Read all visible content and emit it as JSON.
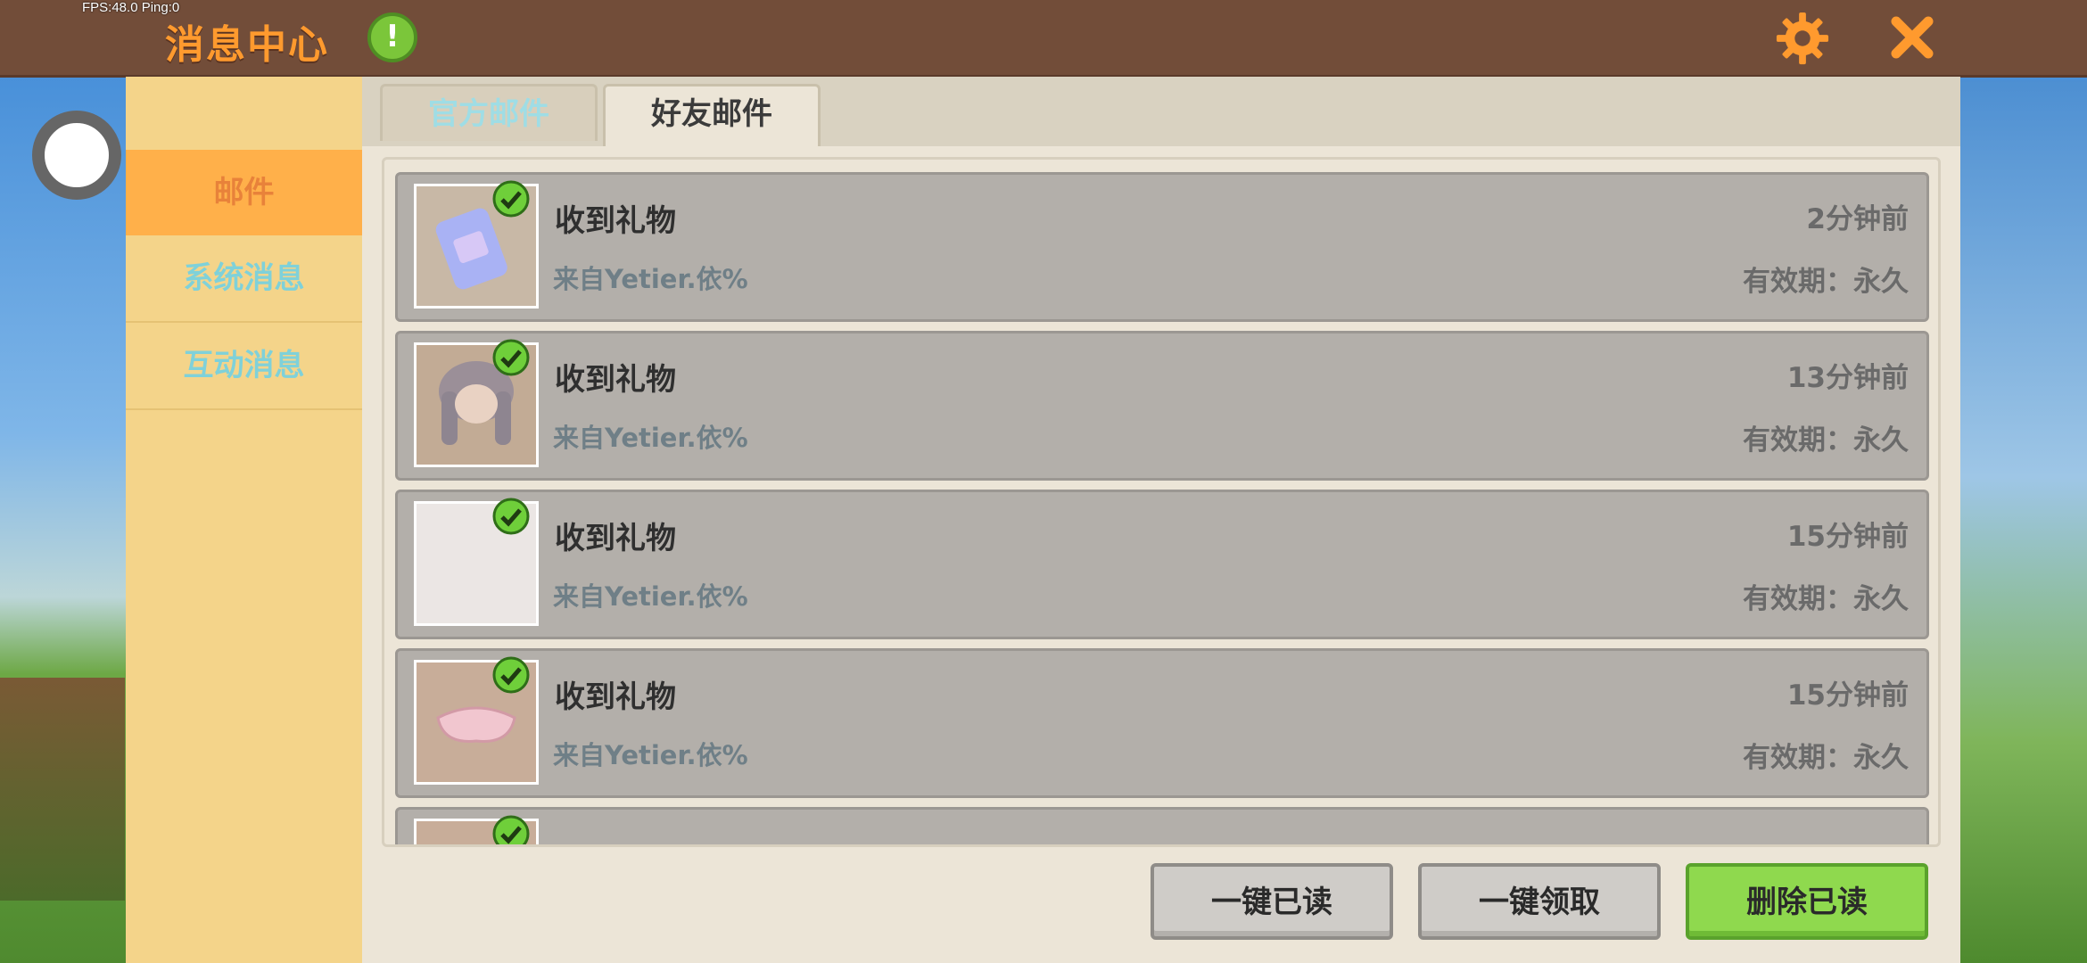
{
  "status": {
    "fps": "FPS:48.0  Ping:0"
  },
  "header": {
    "title": "消息中心"
  },
  "sidebar": {
    "items": [
      {
        "label": "邮件"
      },
      {
        "label": "系统消息"
      },
      {
        "label": "互动消息"
      }
    ]
  },
  "tabs": [
    {
      "label": "官方邮件"
    },
    {
      "label": "好友邮件"
    }
  ],
  "mails": [
    {
      "title": "收到礼物",
      "from": "来自Yetier.依%",
      "time": "2分钟前",
      "expiry": "有效期：永久",
      "icon": "gift-pack-icon"
    },
    {
      "title": "收到礼物",
      "from": "来自Yetier.依%",
      "time": "13分钟前",
      "expiry": "有效期：永久",
      "icon": "hair-item-icon"
    },
    {
      "title": "收到礼物",
      "from": "来自Yetier.依%",
      "time": "15分钟前",
      "expiry": "有效期：永久",
      "icon": "blank-item-icon"
    },
    {
      "title": "收到礼物",
      "from": "来自Yetier.依%",
      "time": "15分钟前",
      "expiry": "有效期：永久",
      "icon": "accessory-item-icon"
    }
  ],
  "actions": {
    "mark_read": "一键已读",
    "claim_all": "一键领取",
    "delete_read": "删除已读"
  },
  "colors": {
    "topbar": "#724d39",
    "title": "#ff9a2e",
    "sidebar": "#f4d48a",
    "active_tab": "#ffb04a",
    "green_button": "#8fd94e"
  }
}
